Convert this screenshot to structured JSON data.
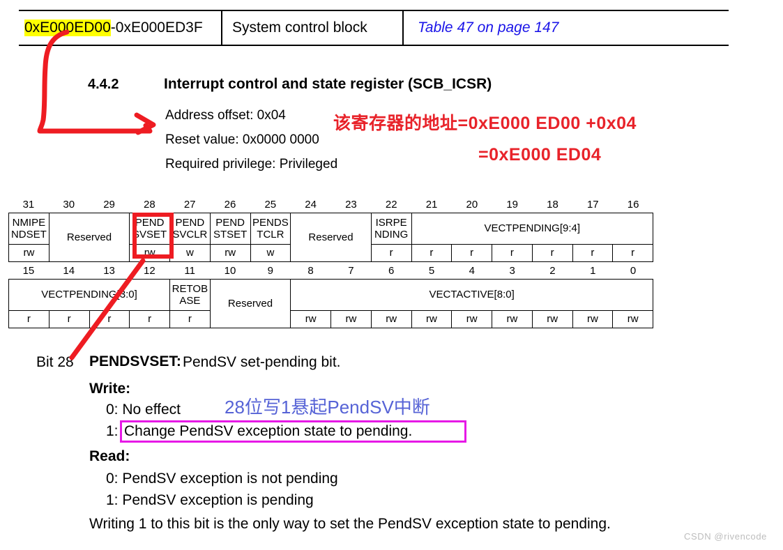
{
  "memory_map_row": {
    "address_range_highlighted": "0xE000ED00",
    "address_range_rest": "-0xE000ED3F",
    "description": "System control block",
    "cross_reference": "Table 47 on page 147",
    "highlight_color": "#ffff00",
    "link_color": "#1a14e8"
  },
  "section": {
    "number": "4.4.2",
    "title": "Interrupt control and state register (SCB_ICSR)",
    "address_offset": "Address offset: 0x04",
    "reset_value": "Reset value: 0x0000 0000",
    "required_privilege": "Required privilege: Privileged"
  },
  "annotations": {
    "red_line_1": "该寄存器的地址=0xE000 ED00 +0x04",
    "red_line_2": "=0xE000 ED04",
    "red_color": "#e8232a",
    "blue_note": "28位写1悬起PendSV中断",
    "blue_color": "#5663d6",
    "pendsv_box_color": "#ee1c22",
    "pink_box_color": "#e619e6"
  },
  "register_table": {
    "high_half": {
      "bit_numbers": [
        "31",
        "30",
        "29",
        "28",
        "27",
        "26",
        "25",
        "24",
        "23",
        "22",
        "21",
        "20",
        "19",
        "18",
        "17",
        "16"
      ],
      "fields": [
        {
          "name": "NMIPE NDSET",
          "span": 1,
          "access": [
            "rw"
          ]
        },
        {
          "name": "Reserved",
          "span": 2,
          "access": [
            "",
            ""
          ]
        },
        {
          "name": "PEND SVSET",
          "span": 1,
          "access": [
            "rw"
          ]
        },
        {
          "name": "PEND SVCLR",
          "span": 1,
          "access": [
            "w"
          ]
        },
        {
          "name": "PEND STSET",
          "span": 1,
          "access": [
            "rw"
          ]
        },
        {
          "name": "PENDS TCLR",
          "span": 1,
          "access": [
            "w"
          ]
        },
        {
          "name": "Reserved",
          "span": 2,
          "access": [
            "",
            ""
          ]
        },
        {
          "name": "ISRPE NDING",
          "span": 1,
          "access": [
            "r"
          ]
        },
        {
          "name": "VECTPENDING[9:4]",
          "span": 6,
          "access": [
            "r",
            "r",
            "r",
            "r",
            "r",
            "r"
          ]
        }
      ]
    },
    "low_half": {
      "bit_numbers": [
        "15",
        "14",
        "13",
        "12",
        "11",
        "10",
        "9",
        "8",
        "7",
        "6",
        "5",
        "4",
        "3",
        "2",
        "1",
        "0"
      ],
      "fields": [
        {
          "name": "VECTPENDING[3:0]",
          "span": 4,
          "access": [
            "r",
            "r",
            "r",
            "r"
          ]
        },
        {
          "name": "RETOB ASE",
          "span": 1,
          "access": [
            "r"
          ]
        },
        {
          "name": "Reserved",
          "span": 2,
          "access": [
            "",
            ""
          ]
        },
        {
          "name": "VECTACTIVE[8:0]",
          "span": 9,
          "access": [
            "rw",
            "rw",
            "rw",
            "rw",
            "rw",
            "rw",
            "rw",
            "rw",
            "rw"
          ]
        }
      ]
    }
  },
  "field_description": {
    "bit_label": "Bit 28",
    "field_name": "PENDSVSET:",
    "field_summary": "PendSV set-pending bit.",
    "write_label": "Write:",
    "write_0": "0: No effect",
    "write_1_num": "1:",
    "write_1_text": "Change PendSV exception state to pending.",
    "read_label": "Read:",
    "read_0": "0: PendSV exception is not pending",
    "read_1": "1: PendSV exception is pending",
    "note": "Writing 1 to this bit is the only way to set the PendSV exception state to pending."
  },
  "watermark": "CSDN @rivencode"
}
